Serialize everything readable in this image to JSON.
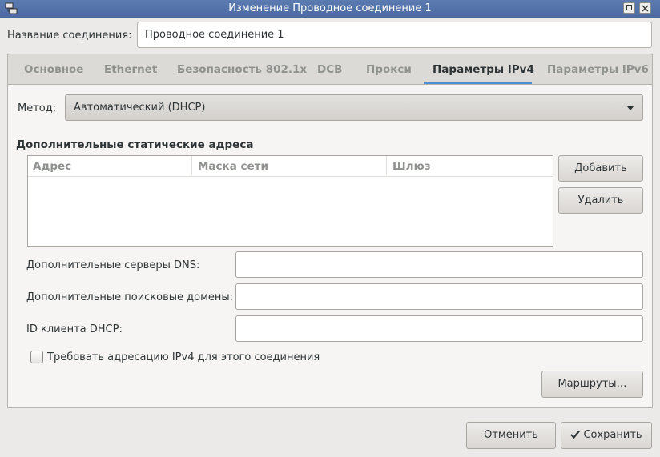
{
  "window": {
    "title": "Изменение Проводное соединение 1",
    "icon": "network-connection-icon"
  },
  "connection": {
    "name_label": "Название соединения:",
    "name_value": "Проводное соединение 1"
  },
  "tabs": [
    {
      "label": "Основное",
      "active": false
    },
    {
      "label": "Ethernet",
      "active": false
    },
    {
      "label": "Безопасность 802.1x",
      "active": false
    },
    {
      "label": "DCB",
      "active": false
    },
    {
      "label": "Прокси",
      "active": false
    },
    {
      "label": "Параметры IPv4",
      "active": true
    },
    {
      "label": "Параметры IPv6",
      "active": false
    }
  ],
  "ipv4": {
    "method_label": "Метод:",
    "method_value": "Автоматический (DHCP)",
    "static_title": "Дополнительные статические адреса",
    "columns": [
      "Адрес",
      "Маска сети",
      "Шлюз"
    ],
    "rows": [],
    "add_button": "Добавить",
    "delete_button": "Удалить",
    "dns_label": "Дополнительные серверы DNS:",
    "dns_value": "",
    "search_label": "Дополнительные поисковые домены:",
    "search_value": "",
    "dhcp_id_label": "ID клиента DHCP:",
    "dhcp_id_value": "",
    "require_label": "Требовать адресацию IPv4 для этого соединения",
    "require_checked": false,
    "routes_button": "Маршруты…"
  },
  "footer": {
    "cancel_button": "Отменить",
    "save_button": "Сохранить"
  },
  "colors": {
    "titlebar": "#4a6aa1",
    "tab_accent": "#4a90d9",
    "window_bg": "#eceae8"
  }
}
